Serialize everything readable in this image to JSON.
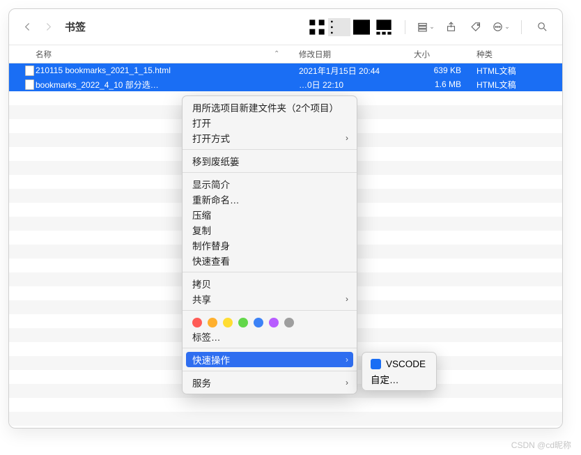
{
  "window": {
    "title": "书签"
  },
  "columns": {
    "name": "名称",
    "date": "修改日期",
    "size": "大小",
    "kind": "种类"
  },
  "files": [
    {
      "name": "210115 bookmarks_2021_1_15.html",
      "date": "2021年1月15日 20:44",
      "size": "639 KB",
      "kind": "HTML文稿"
    },
    {
      "name": "bookmarks_2022_4_10 部分选…",
      "date": "…0日 22:10",
      "size": "1.6 MB",
      "kind": "HTML文稿"
    }
  ],
  "context_menu": {
    "new_folder": "用所选项目新建文件夹（2个项目）",
    "open": "打开",
    "open_with": "打开方式",
    "trash": "移到废纸篓",
    "get_info": "显示简介",
    "rename": "重新命名…",
    "compress": "压缩",
    "duplicate": "复制",
    "alias": "制作替身",
    "quicklook": "快速查看",
    "copy": "拷贝",
    "share": "共享",
    "tags": "标签…",
    "quick_actions": "快速操作",
    "services": "服务"
  },
  "tag_colors": [
    "#ff5b56",
    "#ffb02e",
    "#ffdd33",
    "#63d74a",
    "#3c82f6",
    "#b75cff",
    "#9e9e9e"
  ],
  "submenu": {
    "vscode": "VSCODE",
    "customize": "自定…"
  },
  "watermark": "CSDN @cd昵称"
}
